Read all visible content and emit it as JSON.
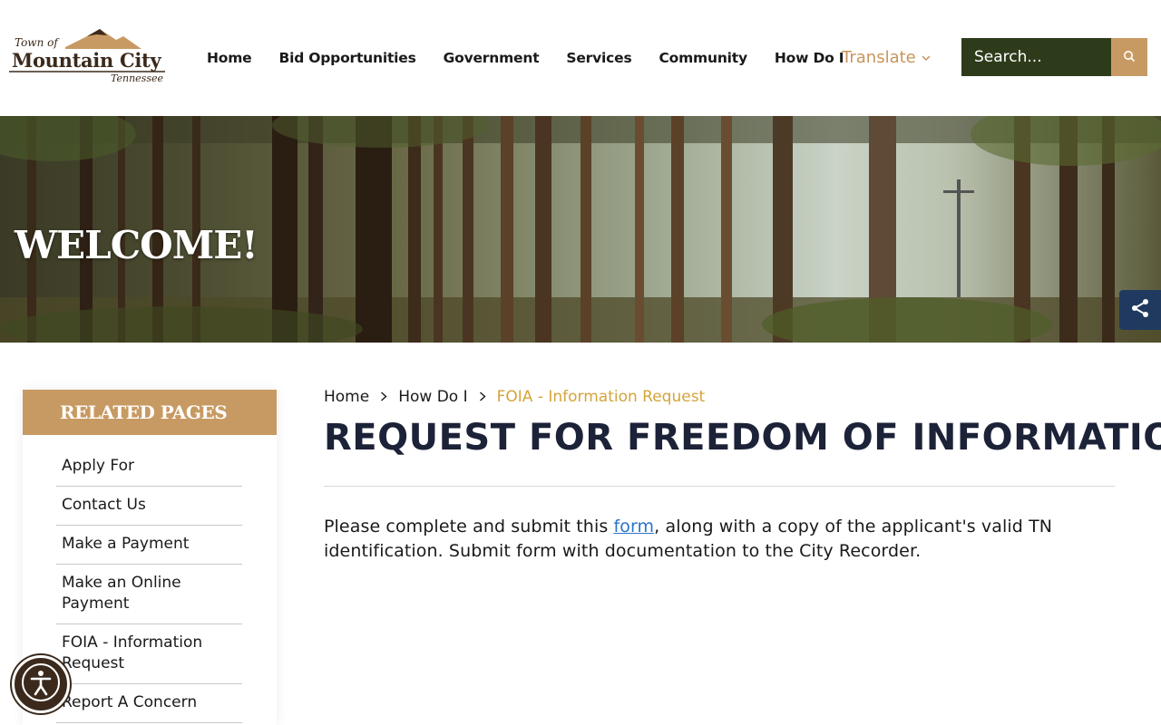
{
  "logo": {
    "town": "Town of",
    "city": "Mountain City",
    "state": "Tennessee"
  },
  "nav": {
    "items": [
      "Home",
      "Bid Opportunities",
      "Government",
      "Services",
      "Community",
      "How Do I"
    ],
    "translate": "Translate"
  },
  "search": {
    "placeholder": "Search..."
  },
  "hero": {
    "title": "WELCOME!"
  },
  "sidebar": {
    "heading": "RELATED PAGES",
    "items": [
      "Apply For",
      "Contact Us",
      "Make a Payment",
      "Make an Online Payment",
      "FOIA - Information Request",
      "Report A Concern"
    ]
  },
  "breadcrumb": {
    "home": "Home",
    "parent": "How Do I",
    "current": "FOIA - Information Request"
  },
  "main": {
    "title": "REQUEST FOR FREEDOM OF INFORMATION",
    "text_before": "Please complete and submit this ",
    "link": "form",
    "text_after": ", along with a copy of the applicant's valid TN identification.  Submit form with documentation to the City Recorder."
  },
  "colors": {
    "brand_brown": "#3b2a1c",
    "accent_tan": "#c89a63",
    "search_green": "#2e3b1a",
    "breadcrumb_gold": "#d4a43a",
    "link_blue": "#2b74c8",
    "share_navy": "#1f3a5e"
  },
  "icons": {
    "search": "search-icon",
    "share": "share-icon",
    "accessibility": "accessibility-icon",
    "chevron": "chevron-down-icon"
  }
}
